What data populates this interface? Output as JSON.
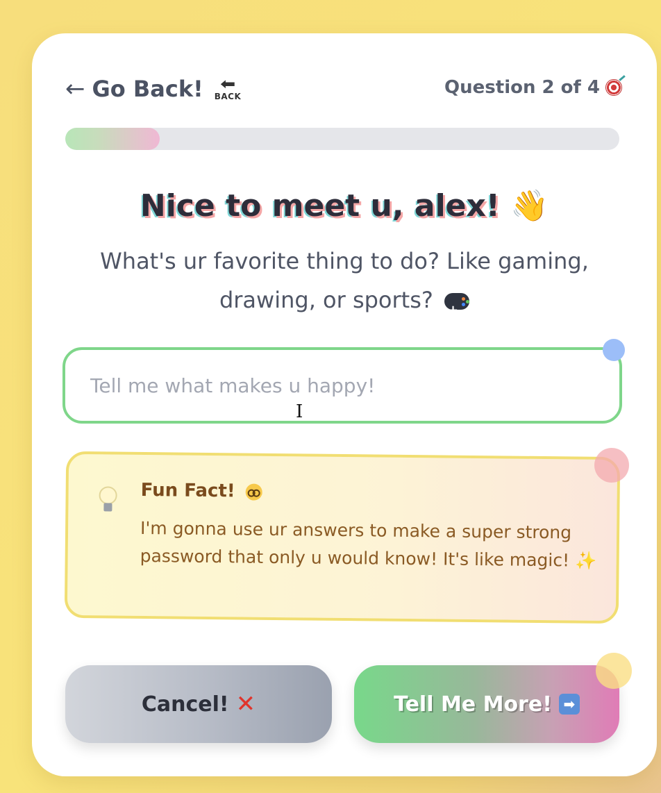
{
  "nav": {
    "back_arrow": "←",
    "back_label": "Go Back!",
    "back_icon_arrow": "⬅",
    "back_icon_text": "BACK",
    "progress_text": "Question 2 of 4"
  },
  "progress": {
    "current": 2,
    "total": 4,
    "fill_fraction": 0.17
  },
  "main": {
    "headline": "Nice to meet u, alex!",
    "headline_emoji": "👋",
    "question": "What's ur favorite thing to do? Like gaming, drawing, or sports?"
  },
  "answer": {
    "placeholder": "Tell me what makes u happy!",
    "value": ""
  },
  "fact": {
    "title": "Fun Fact!",
    "text": "I'm gonna use ur answers to make a super strong password that only u would know! It's like magic!",
    "sparkle": "✨"
  },
  "buttons": {
    "cancel_label": "Cancel!",
    "cancel_icon": "✕",
    "next_label": "Tell Me More!",
    "next_icon": "➡"
  },
  "icons": [
    "back-icon",
    "target-icon",
    "wave-icon",
    "gamepad-icon",
    "bulb-icon",
    "nerd-icon",
    "sparkle-icon",
    "x-icon",
    "arrow-right-icon",
    "text-cursor-icon"
  ],
  "colors": {
    "background": "#f7de7c",
    "input_border": "#7fd68a",
    "fact_border": "#f1de72",
    "next_start": "#78d88a",
    "next_end": "#e07cb6",
    "cancel_start": "#d2d5db",
    "cancel_end": "#9aa1af"
  }
}
